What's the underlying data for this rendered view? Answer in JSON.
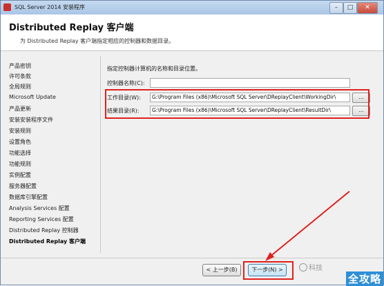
{
  "window": {
    "title": "SQL Server 2014 安装程序",
    "controls": {
      "minimize": "–",
      "maximize": "□",
      "close": "✕"
    }
  },
  "header": {
    "title": "Distributed  Replay 客户端",
    "subtitle": "为 Distributed Replay 客户端指定相应的控制器和数据目录。"
  },
  "sidebar": {
    "items": [
      {
        "label": "产品密钥"
      },
      {
        "label": "许可条款"
      },
      {
        "label": "全局规则"
      },
      {
        "label": "Microsoft Update"
      },
      {
        "label": "产品更新"
      },
      {
        "label": "安装安装程序文件"
      },
      {
        "label": "安装规则"
      },
      {
        "label": "设置角色"
      },
      {
        "label": "功能选择"
      },
      {
        "label": "功能规则"
      },
      {
        "label": "实例配置"
      },
      {
        "label": "服务器配置"
      },
      {
        "label": "数据库引擎配置"
      },
      {
        "label": "Analysis Services 配置"
      },
      {
        "label": "Reporting Services 配置"
      },
      {
        "label": "Distributed Replay 控制器"
      },
      {
        "label": "Distributed Replay 客户端"
      }
    ],
    "active_index": 16
  },
  "content": {
    "description": "指定控制器计算机的名称和目录位置。",
    "controller_label": "控制器名称(C):",
    "controller_value": "",
    "working_dir_label": "工作目录(W):",
    "working_dir_value": "G:\\Program Files (x86)\\Microsoft SQL Server\\DReplayClient\\WorkingDir\\",
    "result_dir_label": "结果目录(R):",
    "result_dir_value": "G:\\Program Files (x86)\\Microsoft SQL Server\\DReplayClient\\ResultDir\\",
    "browse_label": "..."
  },
  "footer": {
    "back_label": "< 上一步(B)",
    "next_label": "下一步(N) >"
  },
  "watermark": {
    "text": "科技",
    "brand": "全攻略"
  },
  "colors": {
    "highlight": "#e0201c",
    "brand_bg": "#2f8fd6"
  }
}
